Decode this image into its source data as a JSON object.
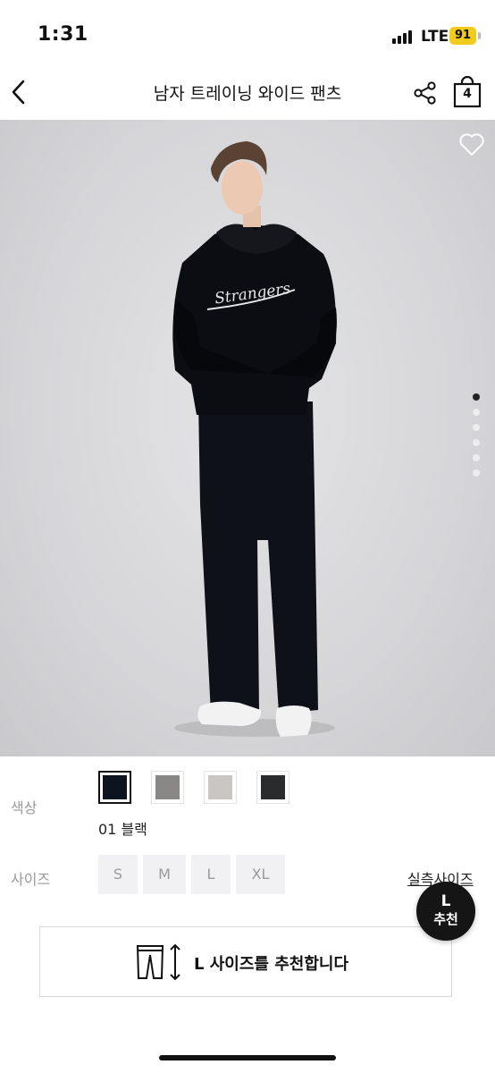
{
  "status_bar": {
    "time": "1:31",
    "network": "LTE",
    "battery": "91",
    "battery_color": "#f2cc1b"
  },
  "nav": {
    "title": "남자 트레이닝 와이드 팬츠",
    "cart_count": "4",
    "icons": [
      "back-icon",
      "share-icon",
      "cart-icon"
    ]
  },
  "gallery": {
    "image_description": "model wearing black hoodie and black wide training pants",
    "total_images": 6,
    "active_index": 0,
    "wishlist_icon": "heart-outline-icon"
  },
  "options": {
    "color_label": "색상",
    "colors": [
      {
        "name": "01 블랙",
        "hex": "#0d1420",
        "selected": true
      },
      {
        "name": "gray",
        "hex": "#8a8886",
        "selected": false
      },
      {
        "name": "light gray",
        "hex": "#c9c6c4",
        "selected": false
      },
      {
        "name": "charcoal",
        "hex": "#2a2b2d",
        "selected": false
      }
    ],
    "selected_color": "01 블랙",
    "size_label": "사이즈",
    "sizes": [
      "S",
      "M",
      "L",
      "XL"
    ],
    "size_guide": "실측사이즈"
  },
  "recommendation": {
    "badge_size": "L",
    "badge_label": "추천",
    "message": "L 사이즈를 추천합니다"
  }
}
